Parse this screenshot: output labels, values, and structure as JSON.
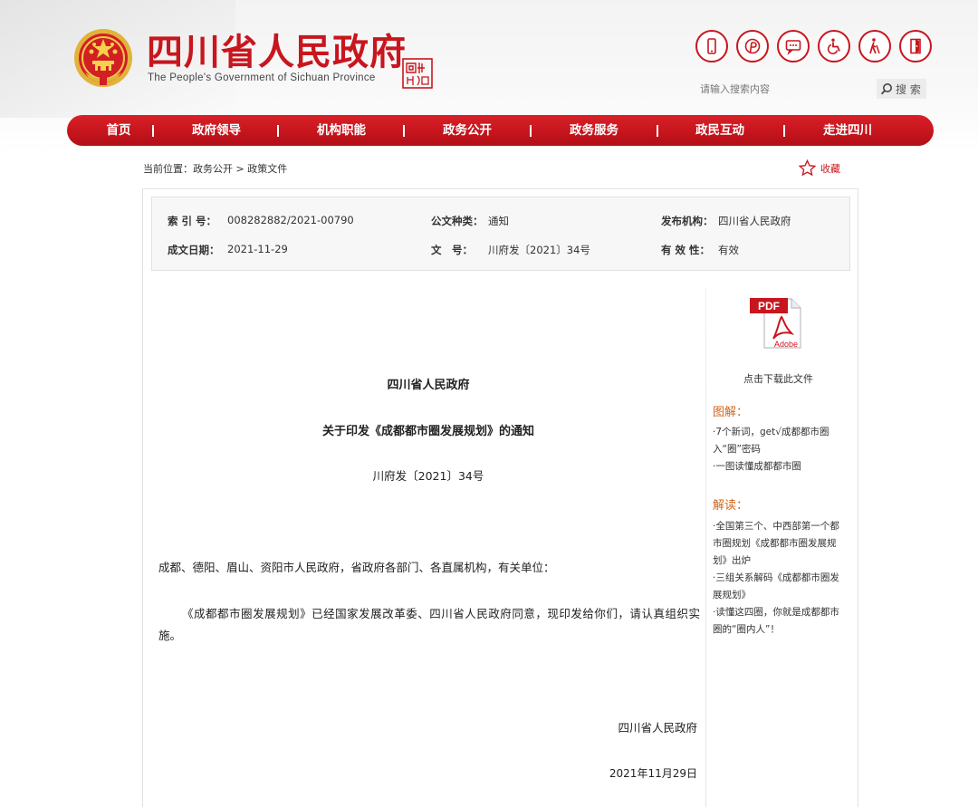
{
  "header": {
    "title": "四川省人民政府",
    "subtitle": "The People's Government of Sichuan Province",
    "accessibility_icons": [
      "mobile-icon",
      "pinterest-icon",
      "chat-icon",
      "wheelchair-icon",
      "elderly-icon",
      "exit-icon"
    ],
    "search": {
      "placeholder": "请输入搜索内容",
      "button_label": "搜 索"
    }
  },
  "nav": {
    "items": [
      {
        "label": "首页"
      },
      {
        "label": "政府领导"
      },
      {
        "label": "机构职能"
      },
      {
        "label": "政务公开"
      },
      {
        "label": "政务服务"
      },
      {
        "label": "政民互动"
      },
      {
        "label": "走进四川"
      }
    ]
  },
  "breadcrumb": {
    "prefix": "当前位置：",
    "level1": "政务公开",
    "separator": ">",
    "level2": "政策文件"
  },
  "favorite": {
    "label": "收藏"
  },
  "meta": {
    "index_label": "索 引 号：",
    "index_value": "008282882/2021-00790",
    "category_label": "公文种类：",
    "category_value": "通知",
    "publisher_label": "发布机构：",
    "publisher_value": "四川省人民政府",
    "date_label": "成文日期：",
    "date_value": "2021-11-29",
    "docno_label": "文　号：",
    "docno_value": "川府发〔2021〕34号",
    "validity_label": "有 效 性：",
    "validity_value": "有效"
  },
  "document": {
    "issuer": "四川省人民政府",
    "title": "关于印发《成都都市圈发展规划》的通知",
    "number": "川府发〔2021〕34号",
    "recipients": "成都、德阳、眉山、资阳市人民政府，省政府各部门、各直属机构，有关单位：",
    "body": "《成都都市圈发展规划》已经国家发展改革委、四川省人民政府同意，现印发给你们，请认真组织实施。",
    "signature": "四川省人民政府",
    "date": "2021年11月29日"
  },
  "sidebar": {
    "download_caption": "点击下载此文件",
    "graphics_heading": "图解：",
    "graphics_items": [
      "·7个新词，get√成都都市圈入“圈”密码",
      "·一图读懂成都都市圈"
    ],
    "interpret_heading": "解读：",
    "interpret_items": [
      "·全国第三个、中西部第一个都市圈规划《成都都市圈发展规划》出炉",
      "·三组关系解码《成都都市圈发展规划》",
      "·读懂这四圈，你就是成都都市圈的“圈内人”！"
    ]
  },
  "colors": {
    "brand_red": "#c8161e",
    "accent_orange": "#d0661c"
  }
}
